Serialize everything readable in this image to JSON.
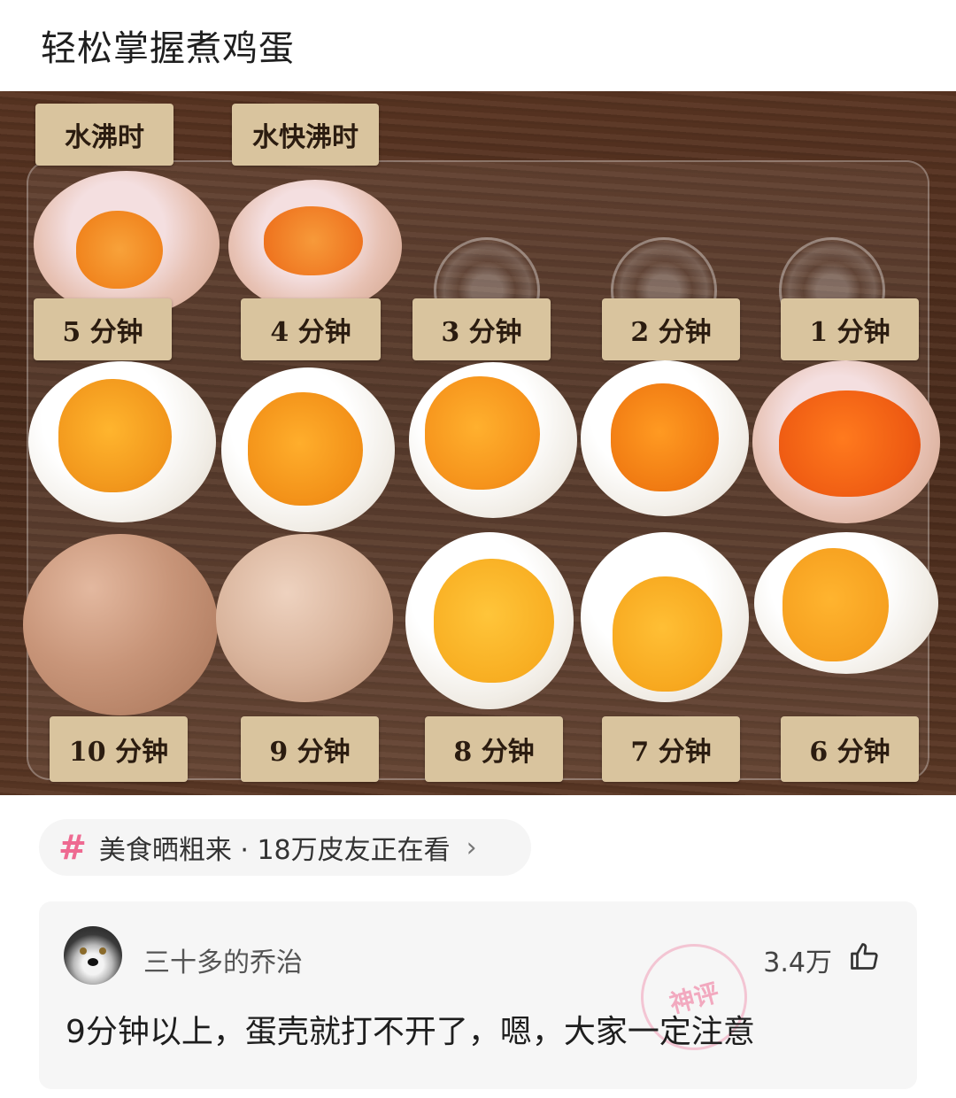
{
  "post": {
    "title": "轻松掌握煮鸡蛋"
  },
  "photo": {
    "top_labels": [
      "水沸时",
      "水快沸时"
    ],
    "row1_labels": [
      "5 分钟",
      "4 分钟",
      "3 分钟",
      "2 分钟",
      "1 分钟"
    ],
    "row2_labels": [
      "10 分钟",
      "9 分钟",
      "8 分钟",
      "7 分钟",
      "6 分钟"
    ]
  },
  "hashtag": {
    "icon": "hashtag-icon",
    "text": "美食晒粗来 · 18万皮友正在看",
    "chevron": "›"
  },
  "comment": {
    "username": "三十多的乔治",
    "likes": "3.4万",
    "text": "9分钟以上，蛋壳就打不开了，嗯，大家一定注意",
    "stamp_text": "神评"
  },
  "colors": {
    "accent": "#ee6a91",
    "label_bg": "#d9c49e",
    "yolk": "#f39a1e"
  }
}
